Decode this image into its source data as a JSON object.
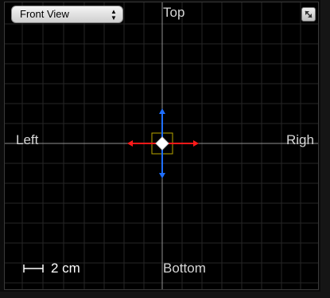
{
  "view_selector": {
    "value": "Front View"
  },
  "orientation": {
    "top": "Top",
    "left": "Left",
    "right": "Righ",
    "bottom": "Bottom"
  },
  "scale_bar": {
    "label": "2 cm"
  },
  "icons": {
    "select_arrows": "up-down-arrows-icon",
    "expand": "expand-icon",
    "gizmo": "move-gizmo-icon"
  },
  "colors": {
    "x_axis_handle": "#ff0000",
    "y_axis_handle": "#1f6fff",
    "selection_box": "#c8b400",
    "grid_line": "#2b2b2b",
    "center_axis": "#9a9a9a"
  }
}
